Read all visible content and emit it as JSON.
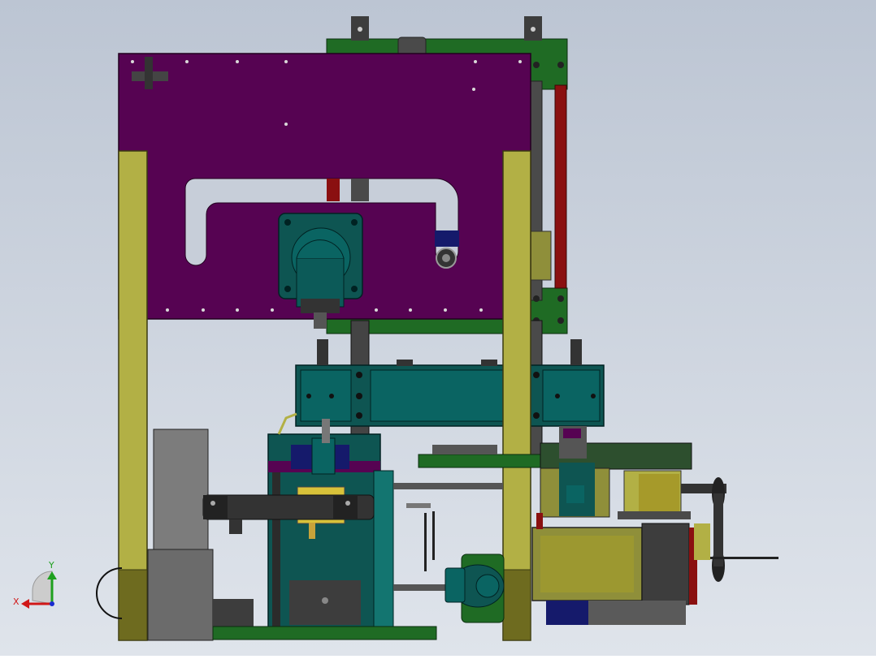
{
  "colors": {
    "bg_top": "#bcc5d3",
    "bg_bottom": "#dfe4eb",
    "purple": "#560352",
    "olive": "#b2b045",
    "green": "#1f6b24",
    "teal": "#0e5552",
    "dark_teal": "#064a48",
    "gray": "#6b6b6b",
    "dark_gray": "#3d3d3d",
    "red": "#8a1010",
    "navy": "#151a6b",
    "yellow": "#d8c23a"
  },
  "triad": {
    "x_label": "X",
    "y_label": "Y"
  }
}
